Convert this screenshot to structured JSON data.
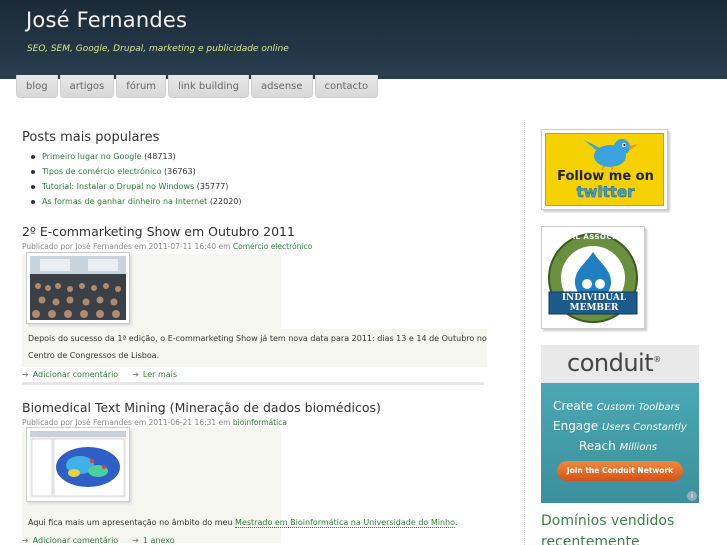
{
  "header": {
    "title": "José Fernandes",
    "slogan": "SEO, SEM, Google, Drupal, marketing e publicidade online"
  },
  "nav": {
    "tabs": [
      "blog",
      "artigos",
      "fórum",
      "link building",
      "adsense",
      "contacto"
    ]
  },
  "popular": {
    "title": "Posts mais populares",
    "items": [
      {
        "link": "Primeiro lugar no Google",
        "count": "(48713)"
      },
      {
        "link": "Tipos de comércio electrónico",
        "count": "(36763)"
      },
      {
        "link": "Tutorial: Instalar o Drupal no Windows",
        "count": "(35777)"
      },
      {
        "link": "As formas de ganhar dinheiro na Internet",
        "count": "(22020)"
      }
    ]
  },
  "posts": [
    {
      "title": "2º E-commarketing Show em Outubro 2011",
      "submitted": "Publicado por José Fernandes em 2011-07-11 16:40 em",
      "taxonomy": "Comércio electrónico",
      "body_line1": "Depois do sucesso da 1ª edição, o E-commarketing Show já tem nova data para 2011: dias 13 e 14 de Outubro no",
      "body_line2": "Centro de Congressos de Lisboa.",
      "link1": "Adicionar comentário",
      "link2": "Ler mais"
    },
    {
      "title": "Biomedical Text Mining (Mineração de dados biomédicos)",
      "submitted": "Publicado por José Fernandes em 2011-06-21 16:31 em",
      "taxonomy": "bioinformática",
      "body_prefix": "Aqui fica mais um apresentação no âmbito do meu",
      "body_link": "Mestrado em Bioinformática na Universidade do Minho",
      "body_suffix": ".",
      "link1": "Adicionar comentário",
      "link2": "1 anexo"
    }
  ],
  "sidebar": {
    "twitter": {
      "line1": "Follow me on",
      "line2": "twitter"
    },
    "drupal": {
      "ring": "DRUPAL ASSOCIATION",
      "banner1": "INDIVIDUAL",
      "banner2": "MEMBER"
    },
    "conduit": {
      "logo": "conduit",
      "reg": "®",
      "line1a": "Create",
      "line1b": "Custom Toolbars",
      "line2a": "Engage",
      "line2b": "Users Constantly",
      "line3a": "Reach",
      "line3b": "Millions",
      "button": "Join the Conduit Network"
    },
    "domains_title": "Domínios vendidos recentemente"
  },
  "colors": {
    "header_bg": "#223444",
    "slogan": "#d8e68a",
    "link_green": "#2e7d3a",
    "conduit_teal": "#3d9aa6"
  }
}
